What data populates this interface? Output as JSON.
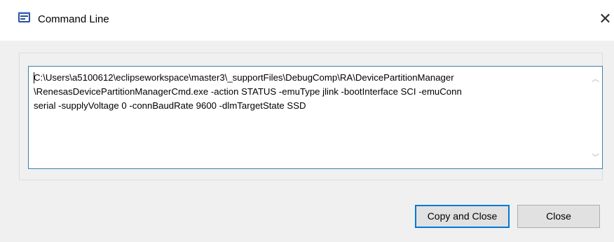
{
  "window": {
    "title": "Command Line",
    "close_glyph": "✕",
    "app_icon": "eclipse-app-icon"
  },
  "command": {
    "text": "C:\\Users\\a5100612\\eclipseworkspace\\master3\\_supportFiles\\DebugComp\\RA\\DevicePartitionManager\n\\RenesasDevicePartitionManagerCmd.exe -action STATUS -emuType jlink -bootInterface SCI -emuConn\nserial -supplyVoltage 0 -connBaudRate 9600 -dlmTargetState SSD"
  },
  "scrollbar": {
    "up_glyph": "︿",
    "down_glyph": "﹀"
  },
  "buttons": {
    "copy_close": "Copy and Close",
    "close": "Close"
  },
  "colors": {
    "focus_border": "#0078d7",
    "textbox_border": "#3c7fb1",
    "dialog_bg": "#f0f0f0"
  }
}
